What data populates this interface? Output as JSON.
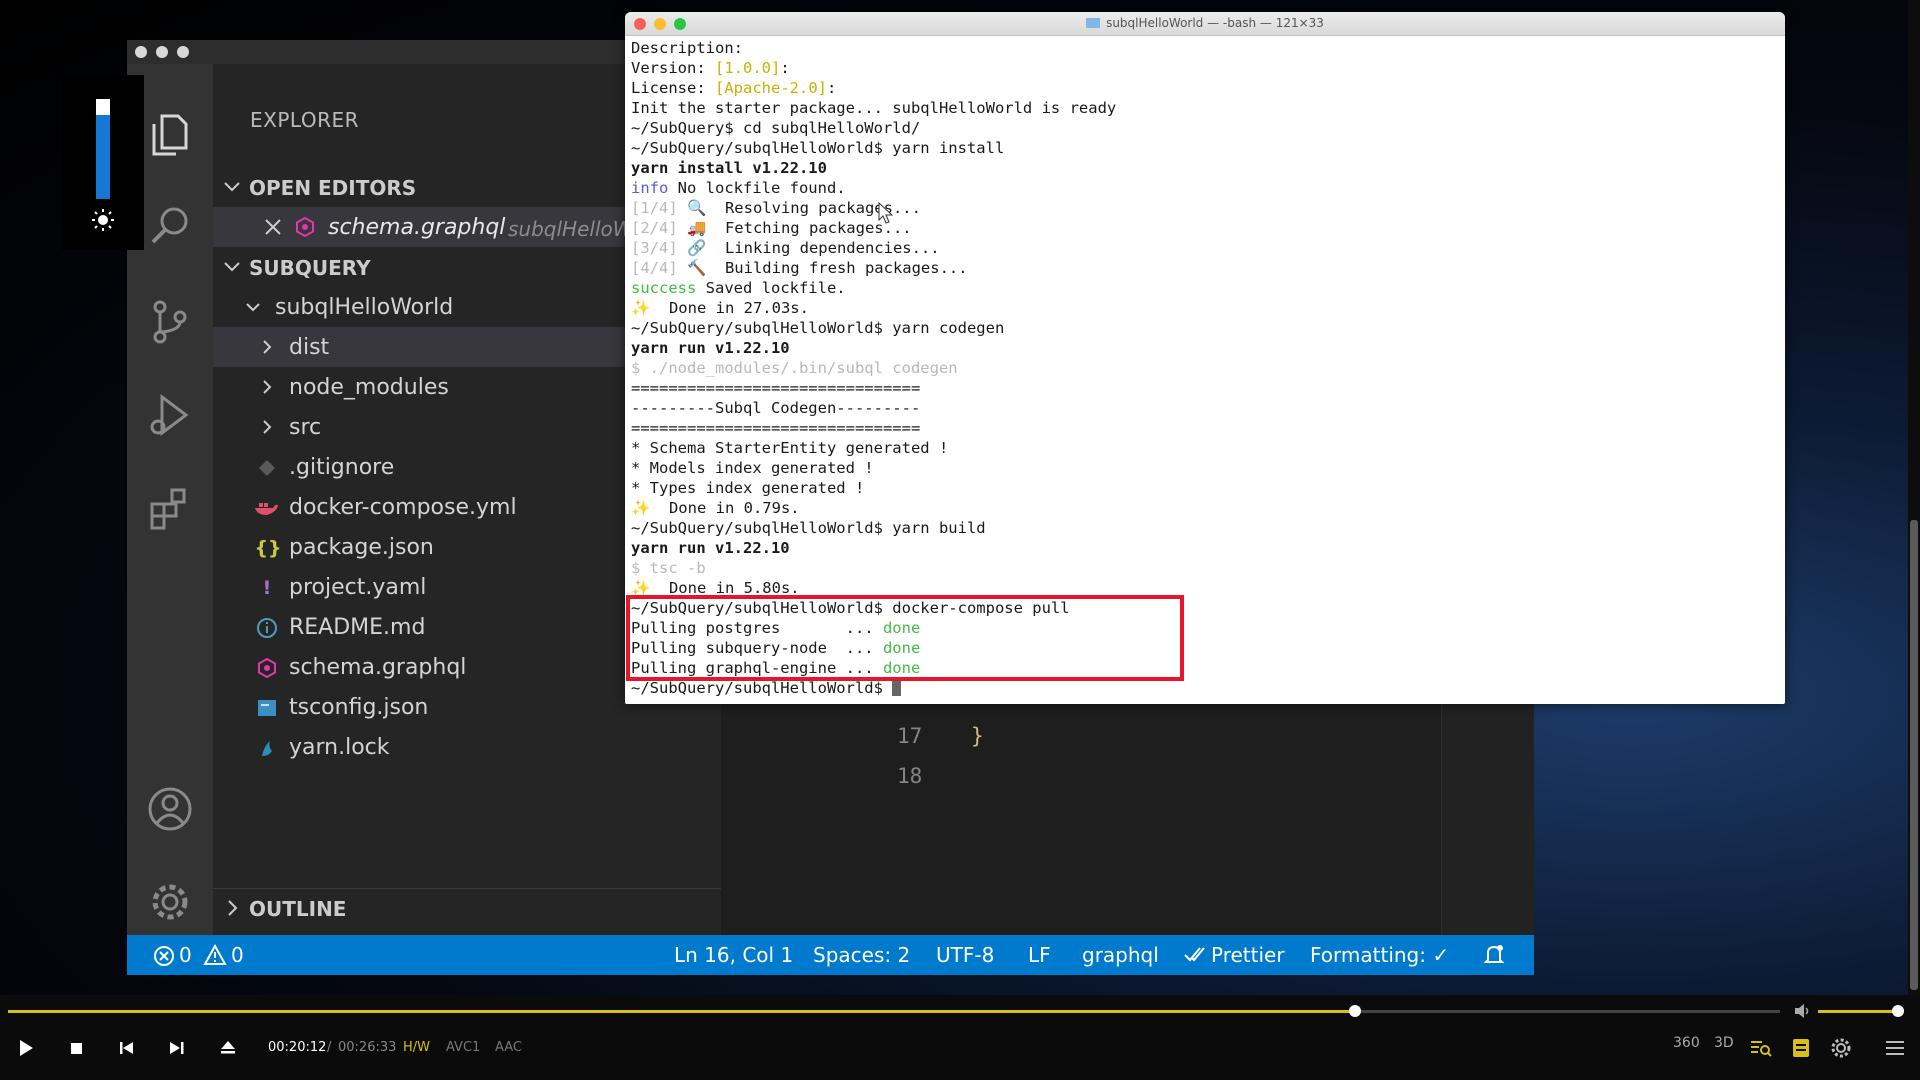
{
  "vscode": {
    "explorer_title": "EXPLORER",
    "open_editors_label": "OPEN EDITORS",
    "open_editor": {
      "name": "schema.graphql",
      "path": "subqlHelloW"
    },
    "subquery_label": "SUBQUERY",
    "project_folder": "subqlHelloWorld",
    "tree": [
      {
        "name": "dist",
        "kind": "folder"
      },
      {
        "name": "node_modules",
        "kind": "folder"
      },
      {
        "name": "src",
        "kind": "folder"
      },
      {
        "name": ".gitignore",
        "kind": "file"
      },
      {
        "name": "docker-compose.yml",
        "kind": "file"
      },
      {
        "name": "package.json",
        "kind": "file"
      },
      {
        "name": "project.yaml",
        "kind": "file"
      },
      {
        "name": "README.md",
        "kind": "file"
      },
      {
        "name": "schema.graphql",
        "kind": "file"
      },
      {
        "name": "tsconfig.json",
        "kind": "file"
      },
      {
        "name": "yarn.lock",
        "kind": "file"
      }
    ],
    "outline_label": "OUTLINE",
    "editor": {
      "line_17": "17",
      "line_18": "18",
      "brace": "}"
    },
    "status": {
      "errors": "0",
      "warnings": "0",
      "position": "Ln 16, Col 1",
      "spaces": "Spaces: 2",
      "encoding": "UTF-8",
      "eol": "LF",
      "language": "graphql",
      "prettier": "Prettier",
      "formatting": "Formatting: ✓"
    }
  },
  "terminal": {
    "title": "subqlHelloWorld — -bash — 121×33",
    "lines": [
      {
        "segments": [
          {
            "t": "Description:"
          }
        ]
      },
      {
        "segments": [
          {
            "t": "Version: "
          },
          {
            "t": "[1.0.0]",
            "c": "yellow"
          },
          {
            "t": ":"
          }
        ]
      },
      {
        "segments": [
          {
            "t": "License: "
          },
          {
            "t": "[Apache-2.0]",
            "c": "yellow"
          },
          {
            "t": ":"
          }
        ]
      },
      {
        "segments": [
          {
            "t": "Init the starter package... subqlHelloWorld is ready"
          }
        ]
      },
      {
        "segments": [
          {
            "t": "~/SubQuery$ cd subqlHelloWorld/"
          }
        ]
      },
      {
        "segments": [
          {
            "t": "~/SubQuery/subqlHelloWorld$ yarn install"
          }
        ]
      },
      {
        "bold": true,
        "segments": [
          {
            "t": "yarn install v1.22.10"
          }
        ]
      },
      {
        "segments": [
          {
            "t": "info",
            "c": "blue"
          },
          {
            "t": " No lockfile found."
          }
        ]
      },
      {
        "segments": [
          {
            "t": "[1/4]",
            "c": "gray"
          },
          {
            "t": " 🔍  Resolving packages..."
          }
        ]
      },
      {
        "segments": [
          {
            "t": "[2/4]",
            "c": "gray"
          },
          {
            "t": " 🚚  Fetching packages..."
          }
        ]
      },
      {
        "segments": [
          {
            "t": "[3/4]",
            "c": "gray"
          },
          {
            "t": " 🔗  Linking dependencies..."
          }
        ]
      },
      {
        "segments": [
          {
            "t": "[4/4]",
            "c": "gray"
          },
          {
            "t": " 🔨  Building fresh packages..."
          }
        ]
      },
      {
        "segments": [
          {
            "t": "success",
            "c": "green"
          },
          {
            "t": " Saved lockfile."
          }
        ]
      },
      {
        "segments": [
          {
            "t": "✨",
            "c": "yellow"
          },
          {
            "t": "  Done in 27.03s."
          }
        ]
      },
      {
        "segments": [
          {
            "t": "~/SubQuery/subqlHelloWorld$ yarn codegen"
          }
        ]
      },
      {
        "bold": true,
        "segments": [
          {
            "t": "yarn run v1.22.10"
          }
        ]
      },
      {
        "dim": true,
        "segments": [
          {
            "t": "$ ./node_modules/.bin/subql codegen"
          }
        ]
      },
      {
        "segments": [
          {
            "t": "==============================="
          }
        ]
      },
      {
        "segments": [
          {
            "t": "---------Subql Codegen---------"
          }
        ]
      },
      {
        "segments": [
          {
            "t": "==============================="
          }
        ]
      },
      {
        "segments": [
          {
            "t": "* Schema StarterEntity generated !"
          }
        ]
      },
      {
        "segments": [
          {
            "t": "* Models index generated !"
          }
        ]
      },
      {
        "segments": [
          {
            "t": "* Types index generated !"
          }
        ]
      },
      {
        "segments": [
          {
            "t": "✨",
            "c": "yellow"
          },
          {
            "t": "  Done in 0.79s."
          }
        ]
      },
      {
        "segments": [
          {
            "t": "~/SubQuery/subqlHelloWorld$ yarn build"
          }
        ]
      },
      {
        "bold": true,
        "segments": [
          {
            "t": "yarn run v1.22.10"
          }
        ]
      },
      {
        "dim": true,
        "segments": [
          {
            "t": "$ tsc -b"
          }
        ]
      },
      {
        "segments": [
          {
            "t": "✨",
            "c": "yellow"
          },
          {
            "t": "  Done in 5.80s."
          }
        ]
      },
      {
        "segments": [
          {
            "t": "~/SubQuery/subqlHelloWorld$ docker-compose pull"
          }
        ]
      },
      {
        "segments": [
          {
            "t": "Pulling postgres       ... "
          },
          {
            "t": "done",
            "c": "green"
          }
        ]
      },
      {
        "segments": [
          {
            "t": "Pulling subquery-node  ... "
          },
          {
            "t": "done",
            "c": "green"
          }
        ]
      },
      {
        "segments": [
          {
            "t": "Pulling graphql-engine ... "
          },
          {
            "t": "done",
            "c": "green"
          }
        ]
      },
      {
        "cursor": true,
        "segments": [
          {
            "t": "~/SubQuery/subqlHelloWorld$ "
          }
        ]
      }
    ]
  },
  "player": {
    "current_time": "00:20:12",
    "separator": "/",
    "total_time": "00:26:33",
    "progress": 0.76,
    "volume": 0.9,
    "badges": {
      "hw": "H/W",
      "video_codec": "AVC1",
      "audio_codec": "AAC",
      "mode_360": "360",
      "mode_3d": "3D"
    }
  },
  "colors": {
    "accent_blue": "#007acc",
    "highlight_red": "#e8142b",
    "player_yellow": "#d4c018",
    "terminal_green": "#3fbf3f",
    "terminal_yellow": "#c9b200"
  }
}
